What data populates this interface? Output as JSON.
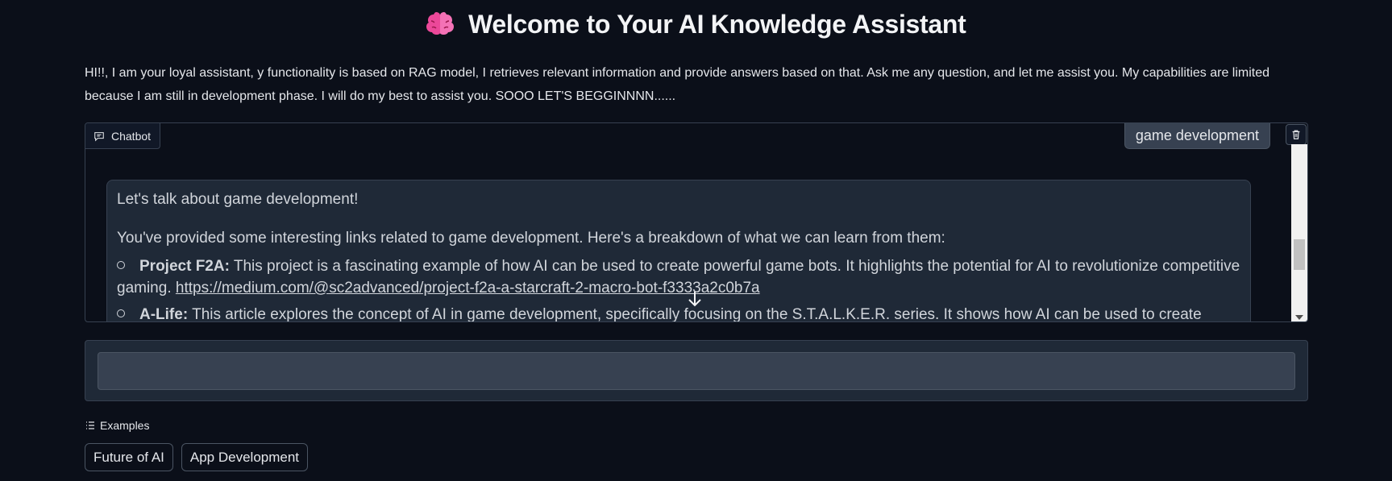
{
  "header": {
    "title": "Welcome to Your AI Knowledge Assistant",
    "icon": "brain-icon"
  },
  "intro": {
    "line1": "HI!!, I am your loyal assistant, y functionality is based on RAG model, I retrieves relevant information and provide answers based on that. Ask me any question, and let me assist you. My capabilities are limited",
    "line2": "because I am still in development phase. I will do my best to assist you. SOOO LET'S BEGGINNNN......"
  },
  "chatbot": {
    "label": "Chatbot",
    "user_message": "game development",
    "bot_message": {
      "intro": "Let's talk about game development!",
      "lead": "You've provided some interesting links related to game development. Here's a breakdown of what we can learn from them:",
      "items": [
        {
          "title": "Project F2A:",
          "text": " This project is a fascinating example of how AI can be used to create powerful game bots. It highlights the potential for AI to revolutionize competitive gaming. ",
          "link": "https://medium.com/@sc2advanced/project-f2a-a-starcraft-2-macro-bot-f3333a2c0b7a"
        },
        {
          "title": "A-Life:",
          "text": " This article explores the concept of AI in game development, specifically focusing on the S.T.A.L.K.E.R. series. It shows how AI can be used to create complex"
        }
      ]
    }
  },
  "input": {
    "placeholder": "",
    "value": ""
  },
  "examples": {
    "label": "Examples",
    "items": [
      "Future of AI",
      "App Development"
    ]
  },
  "colors": {
    "background": "#0b0f19",
    "panel": "#1f2937",
    "border": "#374151",
    "brain": "#ec4899"
  }
}
